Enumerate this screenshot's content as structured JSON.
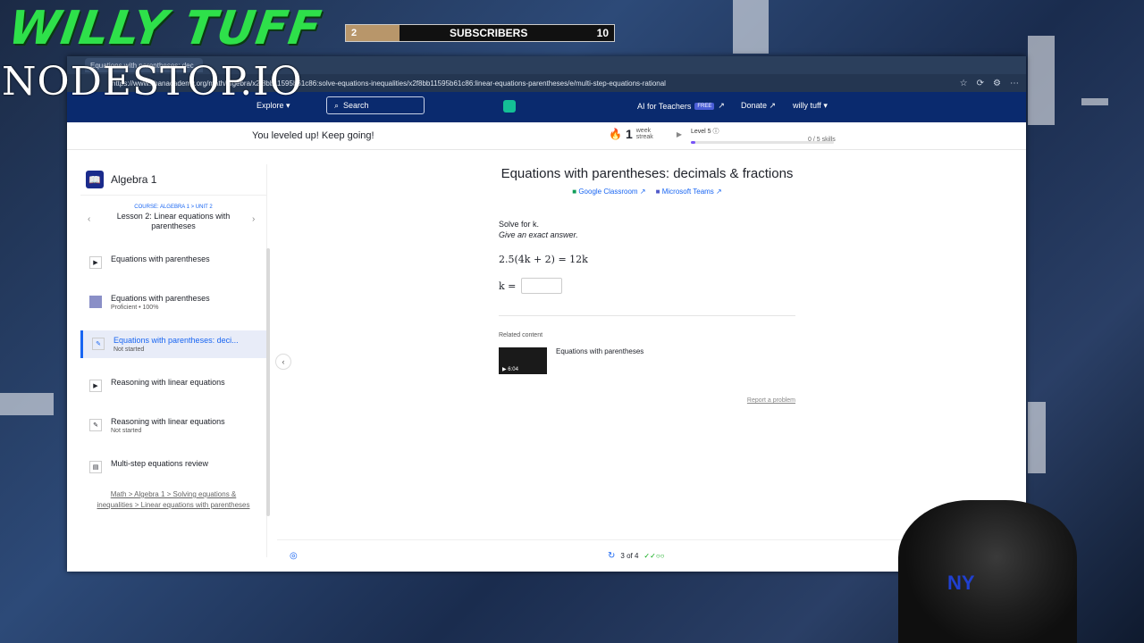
{
  "overlay": {
    "brand": "WILLY TUFF",
    "site": "NODESTOP.IO",
    "subscriber_bar": {
      "left_count": "2",
      "label": "SUBSCRIBERS",
      "right_count": "10",
      "progress": 0.2
    }
  },
  "browser": {
    "tab_title": "Equations with parentheses: dec",
    "url": "https://www.khanacademy.org/math/algebra/x2f8bb11595b61c86:solve-equations-inequalities/x2f8bb11595b61c86:linear-equations-parentheses/e/multi-step-equations-rational"
  },
  "nav": {
    "explore": "Explore ▾",
    "search": "Search",
    "ai_teachers": "AI for Teachers",
    "free_badge": "FREE",
    "donate": "Donate",
    "username": "willy tuff ▾"
  },
  "notice": {
    "message": "You leveled up! Keep going!",
    "streak_num": "1",
    "streak_label_1": "week",
    "streak_label_2": "streak",
    "level": "Level 5 ⓘ",
    "level_progress": 0.02,
    "skills": "0 / 5 skills"
  },
  "sidebar": {
    "title": "Algebra 1",
    "course": "COURSE: ALGEBRA 1 > UNIT 2",
    "lesson": "Lesson 2: Linear equations with parentheses",
    "items": [
      {
        "icon": "▶",
        "label": "Equations with parentheses",
        "sub": ""
      },
      {
        "icon": "",
        "label": "Equations with parentheses",
        "sub": "Proficient • 100%"
      },
      {
        "icon": "✎",
        "label": "Equations with parentheses: deci...",
        "sub": "Not started"
      },
      {
        "icon": "▶",
        "label": "Reasoning with linear equations",
        "sub": ""
      },
      {
        "icon": "✎",
        "label": "Reasoning with linear equations",
        "sub": "Not started"
      },
      {
        "icon": "▤",
        "label": "Multi-step equations review",
        "sub": ""
      }
    ],
    "breadcrumb": "Math > Algebra 1 > Solving equations & inequalities > Linear equations with parentheses"
  },
  "exercise": {
    "title": "Equations with parentheses: decimals & fractions",
    "google_classroom": "Google Classroom",
    "microsoft_teams": "Microsoft Teams",
    "prompt": "Solve for k.",
    "hint": "Give an exact answer.",
    "equation": "2.5(4k + 2) = 12k",
    "answer_label": "k =",
    "related_label": "Related content",
    "related_title": "Equations with parentheses",
    "related_duration": "▶ 6:04",
    "report": "Report a problem"
  },
  "footer": {
    "progress": "3 of 4",
    "checks": "✓✓○○"
  },
  "colors": {
    "accent": "#1865f2",
    "nav_bg": "#0a2a6e",
    "brand_green": "#2ee04a"
  }
}
